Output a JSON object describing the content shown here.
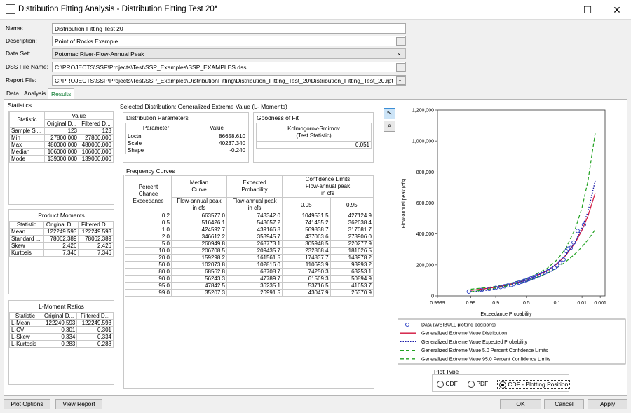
{
  "window": {
    "title": "Distribution Fitting Analysis - Distribution Fitting Test 20*",
    "minimize": "—",
    "maximize": "☐",
    "close": "✕"
  },
  "form": {
    "name_label": "Name:",
    "name_value": "Distribution Fitting Test 20",
    "desc_label": "Description:",
    "desc_value": "Point of Rocks Example",
    "dataset_label": "Data Set:",
    "dataset_value": "Potomac River-Flow-Annual Peak",
    "dss_label": "DSS File Name:",
    "dss_value": "C:\\PROJECTS\\SSP\\Projects\\Test\\SSP_Examples\\SSP_EXAMPLES.dss",
    "report_label": "Report File:",
    "report_value": "C:\\PROJECTS\\SSP\\Projects\\Test\\SSP_Examples\\DistributionFitting\\Distribution_Fitting_Test_20\\Distribution_Fitting_Test_20.rpt",
    "browse": "..."
  },
  "tabs": [
    "Data",
    "Analysis",
    "Results"
  ],
  "statistics": {
    "title": "Statistics",
    "h_stat": "Statistic",
    "h_value": "Value",
    "h_orig": "Original D...",
    "h_filt": "Filtered D...",
    "rows": [
      {
        "name": "Sample Si...",
        "orig": "123",
        "filt": "123"
      },
      {
        "name": "Min",
        "orig": "27800.000",
        "filt": "27800.000"
      },
      {
        "name": "Max",
        "orig": "480000.000",
        "filt": "480000.000"
      },
      {
        "name": "Median",
        "orig": "106000.000",
        "filt": "106000.000"
      },
      {
        "name": "Mode",
        "orig": "139000.000",
        "filt": "139000.000"
      }
    ]
  },
  "moments": {
    "title": "Product Moments",
    "h_stat": "Statistic",
    "h_orig": "Original D...",
    "h_filt": "Filtered D...",
    "rows": [
      {
        "name": "Mean",
        "orig": "122249.593",
        "filt": "122249.593"
      },
      {
        "name": "Standard ...",
        "orig": "78062.389",
        "filt": "78062.389"
      },
      {
        "name": "Skew",
        "orig": "2.426",
        "filt": "2.426"
      },
      {
        "name": "Kurtosis",
        "orig": "7.346",
        "filt": "7.346"
      }
    ]
  },
  "lmoments": {
    "title": "L-Moment Ratios",
    "h_stat": "Statistic",
    "h_orig": "Original D...",
    "h_filt": "Filtered D...",
    "rows": [
      {
        "name": "L-Mean",
        "orig": "122249.593",
        "filt": "122249.593"
      },
      {
        "name": "L-CV",
        "orig": "0.301",
        "filt": "0.301"
      },
      {
        "name": "L-Skew",
        "orig": "0.334",
        "filt": "0.334"
      },
      {
        "name": "L-Kurtosis",
        "orig": "0.283",
        "filt": "0.283"
      }
    ]
  },
  "selected_dist": "Selected Distribution: Generalized Extreme Value (L- Moments)",
  "dist_params": {
    "title": "Distribution Parameters",
    "h_param": "Parameter",
    "h_value": "Value",
    "rows": [
      {
        "name": "Loctn",
        "value": "86658.610"
      },
      {
        "name": "Scale",
        "value": "40237.340"
      },
      {
        "name": "Shape",
        "value": "-0.240"
      }
    ]
  },
  "gof": {
    "title": "Goodness of Fit",
    "header": "Kolmogorov-Smirnov\n(Test Statistic)",
    "value": "0.051"
  },
  "freq": {
    "title": "Frequency Curves",
    "h_pce": "Percent\nChance\nExceedance",
    "h_median": "Median\nCurve",
    "h_median_sub": "Flow-annual peak\nin cfs",
    "h_exp": "Expected\nProbability",
    "h_exp_sub": "Flow-annual peak\nin cfs",
    "h_conf": "Confidence Limits\nFlow-annual peak\nin cfs",
    "h_05": "0.05",
    "h_95": "0.95",
    "rows": [
      [
        "0.2",
        "663577.0",
        "743342.0",
        "1049531.5",
        "427124.9"
      ],
      [
        "0.5",
        "516426.1",
        "543657.2",
        "741455.2",
        "362638.4"
      ],
      [
        "1.0",
        "424592.7",
        "439166.8",
        "569838.7",
        "317081.7"
      ],
      [
        "2.0",
        "346612.2",
        "353945.7",
        "437063.6",
        "273906.0"
      ],
      [
        "5.0",
        "260949.8",
        "263773.1",
        "305948.5",
        "220277.9"
      ],
      [
        "10.0",
        "206708.5",
        "209435.7",
        "232868.4",
        "181626.5"
      ],
      [
        "20.0",
        "159298.2",
        "161561.5",
        "174837.7",
        "143978.2"
      ],
      [
        "50.0",
        "102073.8",
        "102816.0",
        "110693.9",
        "93993.2"
      ],
      [
        "80.0",
        "68562.8",
        "68708.7",
        "74250.3",
        "63253.1"
      ],
      [
        "90.0",
        "56243.3",
        "47789.7",
        "61569.3",
        "50894.9"
      ],
      [
        "95.0",
        "47842.5",
        "36235.1",
        "53716.5",
        "41653.7"
      ],
      [
        "99.0",
        "35207.3",
        "26991.5",
        "43047.9",
        "26370.9"
      ]
    ]
  },
  "chart_data": {
    "type": "line",
    "xlabel": "Exceedance Probability",
    "ylabel": "Flow-annual peak (cfs)",
    "x_ticks": [
      "0.9999",
      "0.99",
      "0.9",
      "0.5",
      "0.1",
      "0.01",
      "0.001"
    ],
    "y_ticks": [
      "0",
      "200,000",
      "400,000",
      "600,000",
      "800,000",
      "1,000,000",
      "1,200,000"
    ],
    "ylim": [
      0,
      1200000
    ],
    "legend": [
      {
        "label": "Data (WEIBULL plotting positions)",
        "color": "#2a3fc4",
        "style": "circle"
      },
      {
        "label": "Generalized Extreme Value Distribution",
        "color": "#d0103a",
        "style": "solid"
      },
      {
        "label": "Generalized Extreme Value Expected Probability",
        "color": "#1a1aa8",
        "style": "dotted"
      },
      {
        "label": "Generalized Extreme Value 5.0 Percent Confidence Limits",
        "color": "#1fa11f",
        "style": "dashed"
      },
      {
        "label": "Generalized Extreme Value 95.0 Percent Confidence Limits",
        "color": "#1fa11f",
        "style": "dashed"
      }
    ],
    "series": [
      {
        "name": "Generalized Extreme Value Distribution",
        "x": [
          0.99,
          0.95,
          0.9,
          0.8,
          0.5,
          0.2,
          0.1,
          0.05,
          0.02,
          0.01,
          0.005,
          0.002
        ],
        "y": [
          35207.3,
          47842.5,
          56243.3,
          68562.8,
          102073.8,
          159298.2,
          206708.5,
          260949.8,
          346612.2,
          424592.7,
          516426.1,
          663577.0
        ]
      },
      {
        "name": "Generalized Extreme Value Expected Probability",
        "x": [
          0.99,
          0.95,
          0.9,
          0.8,
          0.5,
          0.2,
          0.1,
          0.05,
          0.02,
          0.01,
          0.005,
          0.002
        ],
        "y": [
          26991.5,
          36235.1,
          47789.7,
          68708.7,
          102816.0,
          161561.5,
          209435.7,
          263773.1,
          353945.7,
          439166.8,
          543657.2,
          743342.0
        ]
      },
      {
        "name": "Generalized Extreme Value 5.0 Percent Confidence Limits",
        "x": [
          0.99,
          0.95,
          0.9,
          0.8,
          0.5,
          0.2,
          0.1,
          0.05,
          0.02,
          0.01,
          0.005,
          0.002
        ],
        "y": [
          43047.9,
          53716.5,
          61569.3,
          74250.3,
          110693.9,
          174837.7,
          232868.4,
          305948.5,
          437063.6,
          569838.7,
          741455.2,
          1049531.5
        ]
      },
      {
        "name": "Generalized Extreme Value 95.0 Percent Confidence Limits",
        "x": [
          0.99,
          0.95,
          0.9,
          0.8,
          0.5,
          0.2,
          0.1,
          0.05,
          0.02,
          0.01,
          0.005,
          0.002
        ],
        "y": [
          26370.9,
          41653.7,
          50894.9,
          63253.1,
          93993.2,
          143978.2,
          181626.5,
          220277.9,
          273906.0,
          317081.7,
          362638.4,
          427124.9
        ]
      }
    ],
    "points": {
      "name": "Data (WEIBULL plotting positions)",
      "x": [
        0.992,
        0.97,
        0.94,
        0.9,
        0.86,
        0.82,
        0.78,
        0.74,
        0.7,
        0.66,
        0.62,
        0.58,
        0.54,
        0.5,
        0.46,
        0.42,
        0.38,
        0.34,
        0.3,
        0.26,
        0.22,
        0.18,
        0.15,
        0.12,
        0.1,
        0.08,
        0.06,
        0.048,
        0.04,
        0.032,
        0.024,
        0.016,
        0.008
      ],
      "y": [
        27800,
        38000,
        45000,
        52000,
        57000,
        62000,
        67000,
        71000,
        76000,
        81000,
        86000,
        91000,
        97000,
        102000,
        108000,
        114000,
        120000,
        127000,
        134000,
        141000,
        150000,
        160000,
        170000,
        182000,
        196000,
        215000,
        235000,
        290000,
        305000,
        310000,
        345000,
        420000,
        460000
      ]
    }
  },
  "plot_type": {
    "title": "Plot Type",
    "options": [
      "CDF",
      "PDF",
      "CDF - Plotting Position"
    ],
    "selected": 2
  },
  "buttons": {
    "plot_options": "Plot Options",
    "view_report": "View Report",
    "ok": "OK",
    "cancel": "Cancel",
    "apply": "Apply"
  },
  "tools": {
    "pointer": "pointer-icon",
    "zoom": "magnifier-icon"
  }
}
